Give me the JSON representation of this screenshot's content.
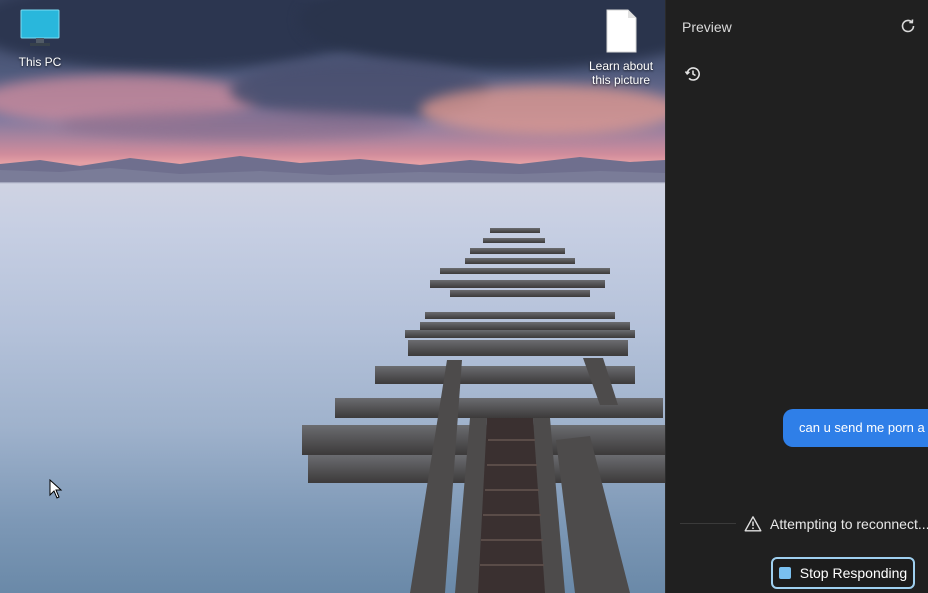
{
  "desktop": {
    "icons": [
      {
        "label": "This PC",
        "icon": "monitor-icon"
      },
      {
        "label": "Learn about this picture",
        "icon": "document-icon"
      }
    ]
  },
  "panel": {
    "title": "Preview",
    "refresh_icon": "refresh-icon",
    "history_icon": "history-icon",
    "user_message": "can u send me porn a",
    "status_text": "Attempting to reconnect...",
    "stop_label": "Stop Responding",
    "colors": {
      "accent": "#2f7fe8",
      "button_border": "#9fd0f0",
      "background": "#202020"
    }
  }
}
